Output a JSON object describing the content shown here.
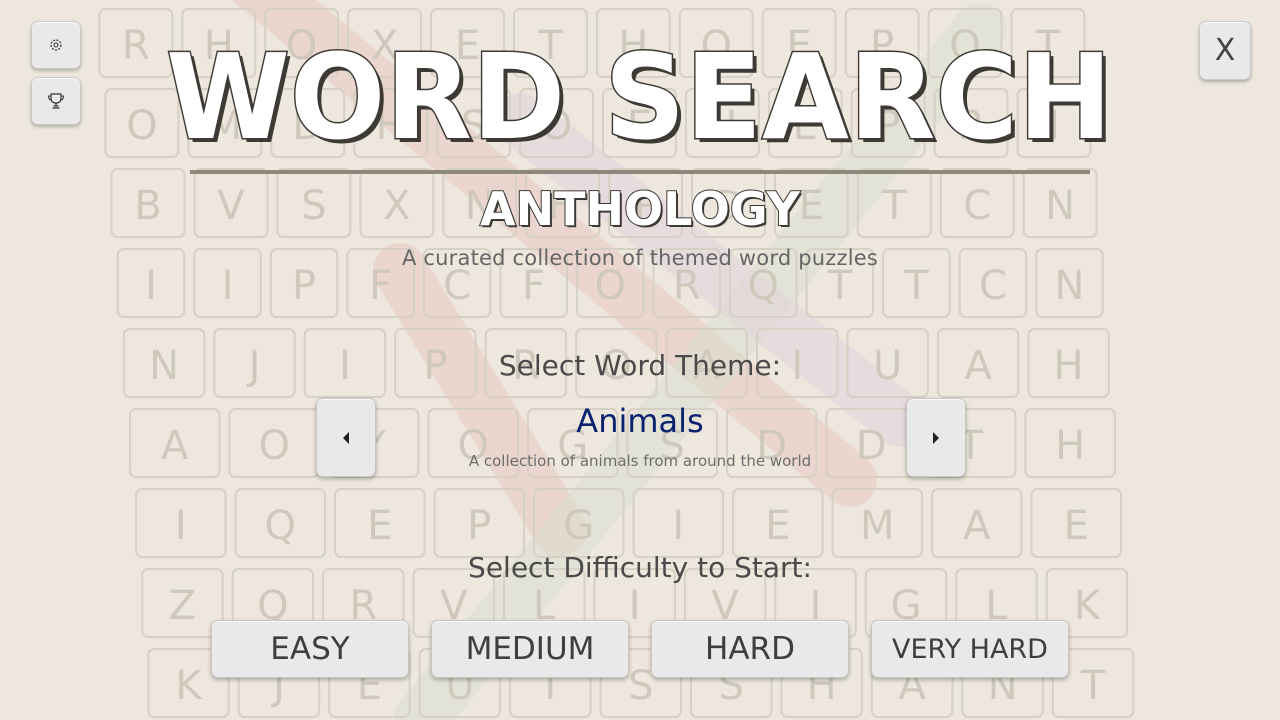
{
  "title": {
    "main": "WORD SEARCH",
    "sub": "ANTHOLOGY",
    "tagline": "A curated collection of themed word puzzles"
  },
  "toolbar": {
    "settings_icon": "gear-icon",
    "achievements_icon": "trophy-icon",
    "exit_label": "X"
  },
  "theme_selector": {
    "label": "Select Word Theme:",
    "current_name": "Animals",
    "current_description": "A collection of animals from around the world",
    "prev_icon": "caret-left-icon",
    "next_icon": "caret-right-icon"
  },
  "difficulty": {
    "label": "Select Difficulty to Start:",
    "options": [
      "EASY",
      "MEDIUM",
      "HARD",
      "VERY HARD"
    ]
  },
  "background_grid": {
    "rows": [
      "RHOXETHQEPOT",
      "OMDHSOEHEPRI",
      "BVSXNHPDETCN",
      "IIPFCFORQTTCN",
      "NJIPROAIUAH",
      "AOYOGSDDTH",
      "IQEPGIEMAE",
      "ZQRVLIVIGLK",
      "KJEUTSSHANT"
    ],
    "colors": {
      "page_bg": "#ede7dd",
      "tile_border": "#d6d0c5",
      "letter": "#cfc9bd",
      "highlight_red": "#e7c9c2",
      "highlight_purple": "#e0d3dc",
      "highlight_green": "#d8dfcf"
    }
  },
  "colors": {
    "title_fill": "#ffffff",
    "title_stroke": "#3d3a35",
    "theme_name": "#0b2270",
    "button_bg": "#e9e9e9",
    "rule": "#8d877c"
  }
}
